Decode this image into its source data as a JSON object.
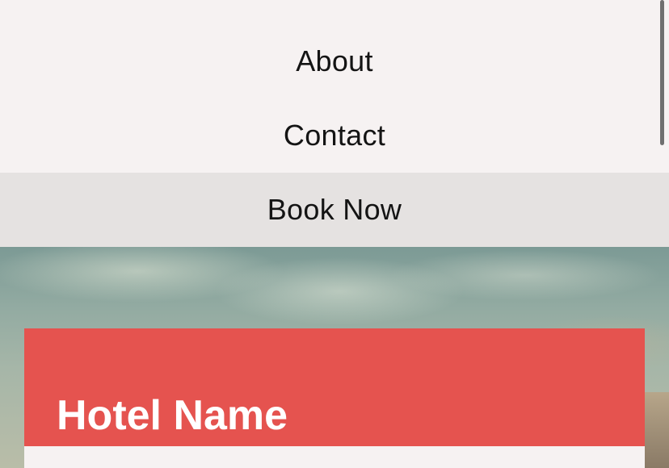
{
  "menu": {
    "items": [
      {
        "label": "About"
      },
      {
        "label": "Contact"
      },
      {
        "label": "Book Now"
      }
    ]
  },
  "hotel_card": {
    "title": "Hotel Name"
  },
  "colors": {
    "menu_background": "#f6f2f2",
    "book_now_background": "#e5e2e1",
    "card_header": "#e5534f",
    "card_title_text": "#ffffff"
  }
}
